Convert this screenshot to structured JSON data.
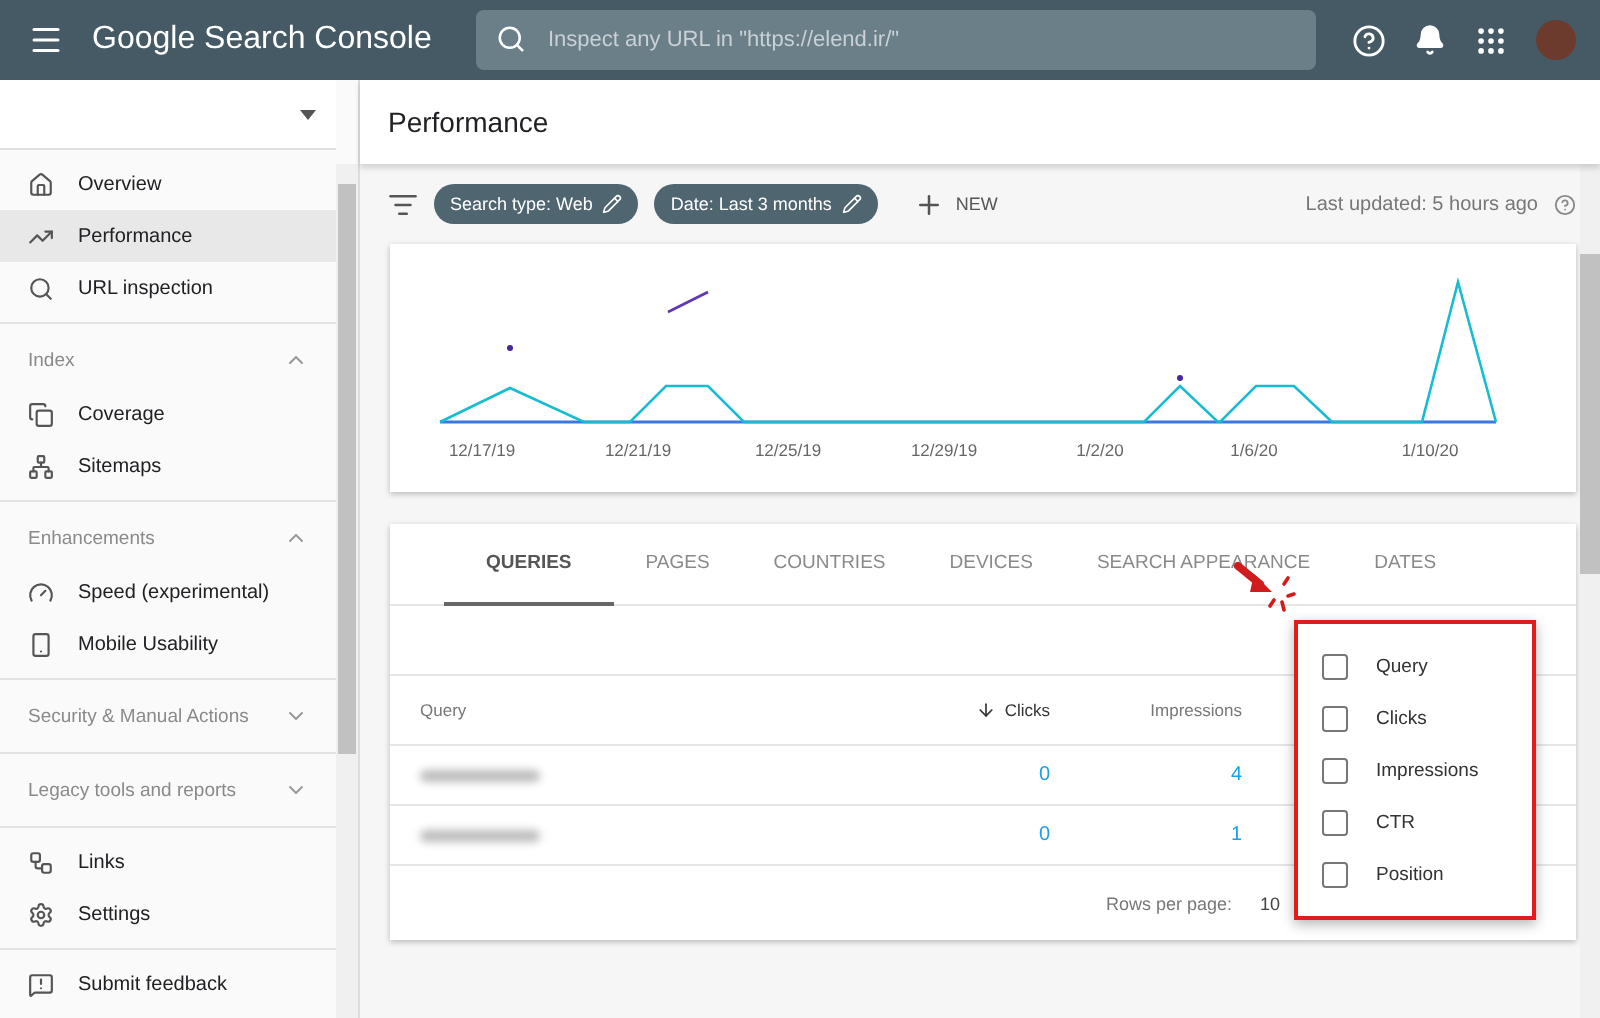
{
  "app_bar": {
    "title": "Google Search Console",
    "search": {
      "placeholder": "Inspect any URL in \"https://elend.ir/\""
    }
  },
  "sidebar": {
    "sections": [
      {
        "items": [
          {
            "label": "Overview",
            "selected": false
          },
          {
            "label": "Performance",
            "selected": true
          },
          {
            "label": "URL inspection",
            "selected": false
          }
        ]
      },
      {
        "heading": "Index",
        "expanded": true,
        "items": [
          {
            "label": "Coverage",
            "selected": false
          },
          {
            "label": "Sitemaps",
            "selected": false
          }
        ]
      },
      {
        "heading": "Enhancements",
        "expanded": true,
        "items": [
          {
            "label": "Speed (experimental)",
            "selected": false
          },
          {
            "label": "Mobile Usability",
            "selected": false
          }
        ]
      },
      {
        "heading": "Security & Manual Actions",
        "expanded": false
      },
      {
        "heading": "Legacy tools and reports",
        "expanded": false
      },
      {
        "items": [
          {
            "label": "Links",
            "selected": false
          },
          {
            "label": "Settings",
            "selected": false
          }
        ]
      },
      {
        "items": [
          {
            "label": "Submit feedback",
            "selected": false
          }
        ]
      }
    ]
  },
  "page": {
    "title": "Performance"
  },
  "filters": {
    "chips": [
      "Search type: Web",
      "Date: Last 3 months"
    ],
    "new_label": "NEW",
    "last_updated": "Last updated: 5 hours ago"
  },
  "chart": {
    "x_labels": [
      "12/17/19",
      "12/21/19",
      "12/25/19",
      "12/29/19",
      "1/2/20",
      "1/6/20",
      "1/10/20"
    ]
  },
  "tabs": [
    {
      "label": "QUERIES",
      "selected": true
    },
    {
      "label": "PAGES",
      "selected": false
    },
    {
      "label": "COUNTRIES",
      "selected": false
    },
    {
      "label": "DEVICES",
      "selected": false
    },
    {
      "label": "SEARCH APPEARANCE",
      "selected": false
    },
    {
      "label": "DATES",
      "selected": false
    }
  ],
  "table": {
    "columns": [
      {
        "label": "Query",
        "sorted": false
      },
      {
        "label": "Clicks",
        "sorted": true
      },
      {
        "label": "Impressions",
        "sorted": false
      }
    ],
    "rows": [
      {
        "clicks": "0",
        "impressions": "4"
      },
      {
        "clicks": "0",
        "impressions": "1"
      }
    ],
    "rows_per_page_label": "Rows per page:",
    "rows_per_page": "10"
  },
  "column_menu": [
    {
      "label": "Query",
      "checked": false
    },
    {
      "label": "Clicks",
      "checked": false
    },
    {
      "label": "Impressions",
      "checked": false
    },
    {
      "label": "CTR",
      "checked": false
    },
    {
      "label": "Position",
      "checked": false
    }
  ]
}
